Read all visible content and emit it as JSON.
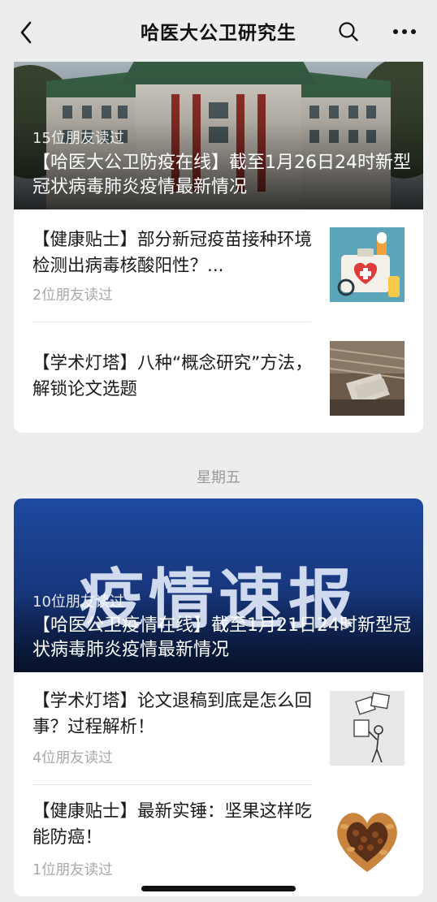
{
  "header": {
    "title": "哈医大公卫研究生",
    "back_icon": "chevron-left-icon",
    "search_icon": "search-icon",
    "more_icon": "more-dots-icon"
  },
  "group1": {
    "cover": {
      "reads": "15位朋友读过",
      "title": "【哈医大公卫防疫在线】截至1月26日24时新型冠状病毒肺炎疫情最新情况"
    },
    "items": [
      {
        "title": "【健康贴士】部分新冠疫苗接种环境检测出病毒核酸阳性？...",
        "reads": "2位朋友读过"
      },
      {
        "title": "【学术灯塔】八种“概念研究”方法，解锁论文选题",
        "reads": ""
      }
    ]
  },
  "date_label": "星期五",
  "group2": {
    "cover": {
      "banner": "疫情速报",
      "reads": "10位朋友读过",
      "title": "【哈医公卫疫情在线】截至1月21日24时新型冠状病毒肺炎疫情最新情况"
    },
    "items": [
      {
        "title": "【学术灯塔】论文退稿到底是怎么回事？过程解析！",
        "reads": "4位朋友读过"
      },
      {
        "title": "【健康贴士】最新实锤：坚果这样吃能防癌！",
        "reads": "1位朋友读过"
      }
    ]
  },
  "colors": {
    "background": "#ededed",
    "card": "#ffffff",
    "muted": "#a8a8a8",
    "banner_blue": "#1b3f8f"
  }
}
